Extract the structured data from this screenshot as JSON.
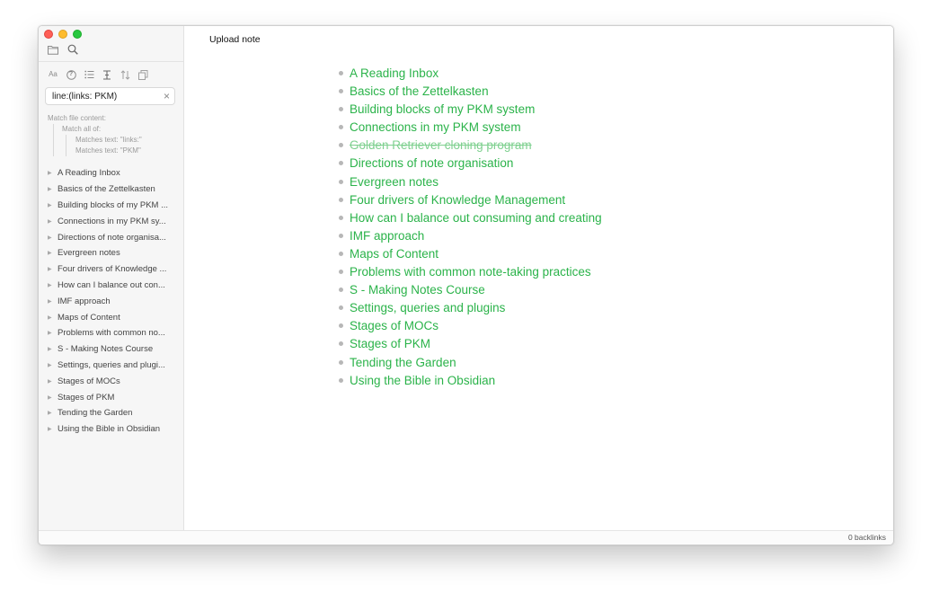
{
  "search": {
    "query": "line:(links: PKM)",
    "explain": {
      "header": "Match file content:",
      "match_all": "Match all of:",
      "terms": [
        "Matches text: \"links:\"",
        "Matches text: \"PKM\""
      ]
    }
  },
  "toolbar": {
    "case_label": "Aa",
    "help_glyph": "?"
  },
  "results": [
    "A Reading Inbox",
    "Basics of the Zettelkasten",
    "Building blocks of my PKM ...",
    "Connections in my PKM sy...",
    "Directions of note organisa...",
    "Evergreen notes",
    "Four drivers of Knowledge ...",
    "How can I balance out con...",
    "IMF approach",
    "Maps of Content",
    "Problems with common no...",
    "S - Making Notes Course",
    "Settings, queries and plugi...",
    "Stages of MOCs",
    "Stages of PKM",
    "Tending the Garden",
    "Using the Bible in Obsidian"
  ],
  "note": {
    "title": "Upload note",
    "links": [
      {
        "text": "A Reading Inbox",
        "struck": false
      },
      {
        "text": "Basics of the Zettelkasten",
        "struck": false
      },
      {
        "text": "Building blocks of my PKM system",
        "struck": false
      },
      {
        "text": "Connections in my PKM system",
        "struck": false
      },
      {
        "text": "Golden Retriever cloning program",
        "struck": true
      },
      {
        "text": "Directions of note organisation",
        "struck": false
      },
      {
        "text": "Evergreen notes",
        "struck": false
      },
      {
        "text": "Four drivers of Knowledge Management",
        "struck": false
      },
      {
        "text": "How can I balance out consuming and creating",
        "struck": false
      },
      {
        "text": "IMF approach",
        "struck": false
      },
      {
        "text": "Maps of Content",
        "struck": false
      },
      {
        "text": "Problems with common note-taking practices",
        "struck": false
      },
      {
        "text": "S - Making Notes Course",
        "struck": false
      },
      {
        "text": "Settings, queries and plugins",
        "struck": false
      },
      {
        "text": "Stages of MOCs",
        "struck": false
      },
      {
        "text": "Stages of PKM",
        "struck": false
      },
      {
        "text": "Tending the Garden",
        "struck": false
      },
      {
        "text": "Using the Bible in Obsidian",
        "struck": false
      }
    ]
  },
  "status": {
    "backlinks": "0 backlinks"
  },
  "colors": {
    "link": "#2bb34a",
    "struck_link": "#7ed08f",
    "close": "#fe5f57",
    "minimize": "#febc2e",
    "maximize": "#28c840"
  },
  "icons": {
    "folder": "folder-icon",
    "search": "search-icon",
    "case": "match-case-icon",
    "help": "help-icon",
    "list": "list-icon",
    "text_cursor": "text-cursor-icon",
    "sort": "sort-icon",
    "copy": "copy-icon",
    "clear": "clear-search-icon",
    "bullet": "bullet-icon",
    "disclosure": "disclosure-triangle-icon"
  }
}
